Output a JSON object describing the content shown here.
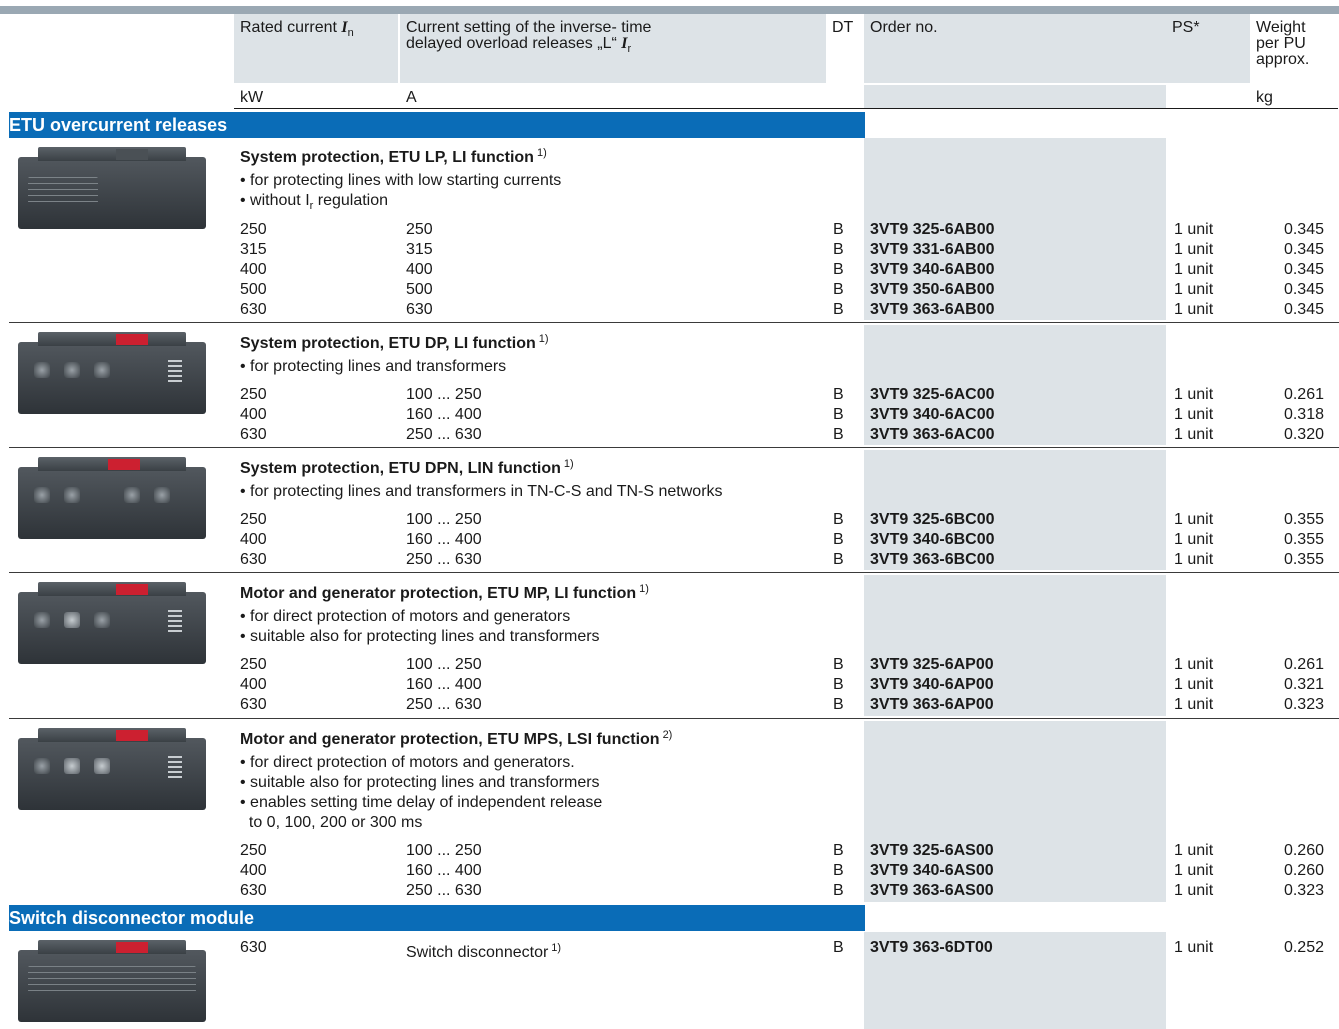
{
  "header": {
    "col_rated_current": "Rated current",
    "col_rated_current_symbol": "I",
    "col_rated_current_sub": "n",
    "col_current_setting_line1": "Current setting of the inverse- time",
    "col_current_setting_line2": "delayed overload releases „L“",
    "col_current_setting_symbol": "I",
    "col_current_setting_sub": "r",
    "col_dt": "DT",
    "col_order_no": "Order no.",
    "col_ps": "PS*",
    "col_weight_line1": "Weight",
    "col_weight_line2": "per PU",
    "col_weight_line3": "approx.",
    "unit_kw": "kW",
    "unit_a": "A",
    "unit_kg": "kg"
  },
  "sections": [
    {
      "title": "ETU overcurrent releases"
    },
    {
      "title": "Switch disconnector module"
    }
  ],
  "groups": [
    {
      "title": "System protection, ETU LP, LI function",
      "footnote": "1)",
      "bullets": [
        "• for protecting lines with low starting currents",
        "• without I"
      ],
      "bullet2_sub": "r",
      "bullet2_tail": " regulation",
      "rows": [
        {
          "rated": "250",
          "setting": "250",
          "dt": "B",
          "order": "3VT9 325-6AB00",
          "ps": "1 unit",
          "weight": "0.345"
        },
        {
          "rated": "315",
          "setting": "315",
          "dt": "B",
          "order": "3VT9 331-6AB00",
          "ps": "1 unit",
          "weight": "0.345"
        },
        {
          "rated": "400",
          "setting": "400",
          "dt": "B",
          "order": "3VT9 340-6AB00",
          "ps": "1 unit",
          "weight": "0.345"
        },
        {
          "rated": "500",
          "setting": "500",
          "dt": "B",
          "order": "3VT9 350-6AB00",
          "ps": "1 unit",
          "weight": "0.345"
        },
        {
          "rated": "630",
          "setting": "630",
          "dt": "B",
          "order": "3VT9 363-6AB00",
          "ps": "1 unit",
          "weight": "0.345"
        }
      ]
    },
    {
      "title": "System protection, ETU DP, LI function",
      "footnote": "1)",
      "bullets": [
        "• for protecting lines and transformers"
      ],
      "rows": [
        {
          "rated": "250",
          "setting": "100 ... 250",
          "dt": "B",
          "order": "3VT9 325-6AC00",
          "ps": "1 unit",
          "weight": "0.261"
        },
        {
          "rated": "400",
          "setting": "160 ... 400",
          "dt": "B",
          "order": "3VT9 340-6AC00",
          "ps": "1 unit",
          "weight": "0.318"
        },
        {
          "rated": "630",
          "setting": "250 ... 630",
          "dt": "B",
          "order": "3VT9 363-6AC00",
          "ps": "1 unit",
          "weight": "0.320"
        }
      ]
    },
    {
      "title": "System protection, ETU DPN, LIN function",
      "footnote": "1)",
      "bullets": [
        "• for protecting lines and transformers in TN-C-S and TN-S networks"
      ],
      "rows": [
        {
          "rated": "250",
          "setting": "100 ... 250",
          "dt": "B",
          "order": "3VT9 325-6BC00",
          "ps": "1 unit",
          "weight": "0.355"
        },
        {
          "rated": "400",
          "setting": "160 ... 400",
          "dt": "B",
          "order": "3VT9 340-6BC00",
          "ps": "1 unit",
          "weight": "0.355"
        },
        {
          "rated": "630",
          "setting": "250 ... 630",
          "dt": "B",
          "order": "3VT9 363-6BC00",
          "ps": "1 unit",
          "weight": "0.355"
        }
      ]
    },
    {
      "title": "Motor and generator protection, ETU MP, LI function",
      "footnote": "1)",
      "bullets": [
        "• for direct protection of motors and generators",
        "• suitable also for protecting lines and transformers"
      ],
      "rows": [
        {
          "rated": "250",
          "setting": "100 ... 250",
          "dt": "B",
          "order": "3VT9 325-6AP00",
          "ps": "1 unit",
          "weight": "0.261"
        },
        {
          "rated": "400",
          "setting": "160 ... 400",
          "dt": "B",
          "order": "3VT9 340-6AP00",
          "ps": "1 unit",
          "weight": "0.321"
        },
        {
          "rated": "630",
          "setting": "250 ... 630",
          "dt": "B",
          "order": "3VT9 363-6AP00",
          "ps": "1 unit",
          "weight": "0.323"
        }
      ]
    },
    {
      "title": "Motor and generator protection, ETU MPS, LSI function",
      "footnote": "2)",
      "bullets": [
        "• for direct protection of motors and generators.",
        "• suitable also for protecting lines and transformers",
        "• enables setting time delay of independent release",
        "  to 0, 100, 200 or 300 ms"
      ],
      "rows": [
        {
          "rated": "250",
          "setting": "100 ... 250",
          "dt": "B",
          "order": "3VT9 325-6AS00",
          "ps": "1 unit",
          "weight": "0.260"
        },
        {
          "rated": "400",
          "setting": "160 ... 400",
          "dt": "B",
          "order": "3VT9 340-6AS00",
          "ps": "1 unit",
          "weight": "0.260"
        },
        {
          "rated": "630",
          "setting": "250 ... 630",
          "dt": "B",
          "order": "3VT9 363-6AS00",
          "ps": "1 unit",
          "weight": "0.323"
        }
      ]
    }
  ],
  "switch_row": {
    "rated": "630",
    "setting": "Switch disconnector",
    "footnote": "1)",
    "dt": "B",
    "order": "3VT9 363-6DT00",
    "ps": "1 unit",
    "weight": "0.252"
  },
  "colors": {
    "section_blue": "#0a6cb7",
    "header_gray": "#dde3e7",
    "top_bar": "#9aa8b3",
    "indicator_red": "#cc2030"
  },
  "icons": [
    "etu-lp-release-image",
    "etu-dp-release-image",
    "etu-dpn-release-image",
    "etu-mp-release-image",
    "etu-mps-release-image",
    "switch-disconnector-image"
  ]
}
